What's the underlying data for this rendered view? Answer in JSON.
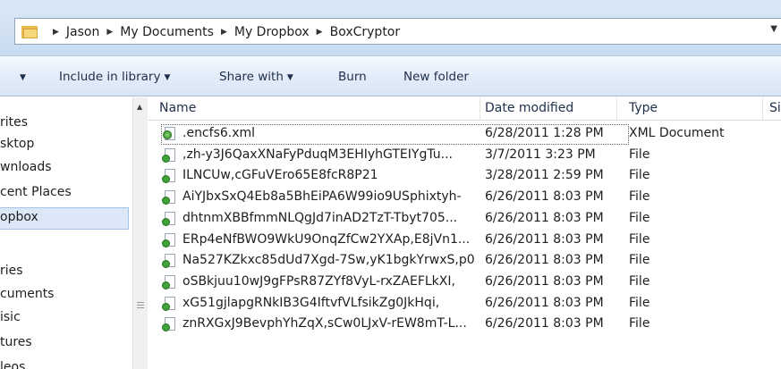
{
  "address_bar": {
    "crumbs": [
      "Jason",
      "My Documents",
      "My Dropbox",
      "BoxCryptor"
    ],
    "separator": "▶",
    "dropdown": "▼"
  },
  "toolbar": {
    "organize_caret": "▼",
    "include_in_library": "Include in library",
    "share_with": "Share with",
    "burn": "Burn",
    "new_folder": "New folder",
    "caret": "▼"
  },
  "nav": {
    "items": [
      "rites",
      "sktop",
      "wnloads",
      "cent Places",
      "opbox",
      "ries",
      "cuments",
      "isic",
      "tures",
      "leos"
    ],
    "selected_index": 4
  },
  "list": {
    "columns": [
      "Name",
      "Date modified",
      "Type",
      "Si"
    ],
    "files": [
      {
        "name": ".encfs6.xml",
        "date": "6/28/2011 1:28 PM",
        "type": "XML Document",
        "icon": "xml-file-icon"
      },
      {
        "name": ",zh-y3J6QaxXNaFyPduqM3EHIyhGTEIYgTu...",
        "date": "3/7/2011 3:23 PM",
        "type": "File",
        "icon": "file-icon"
      },
      {
        "name": "ILNCUw,cGFuVEro65E8fcR8P21",
        "date": "3/28/2011 2:59 PM",
        "type": "File",
        "icon": "file-icon"
      },
      {
        "name": "AiYJbxSxQ4Eb8a5BhEiPA6W99io9USphixtyh-",
        "date": "6/26/2011 8:03 PM",
        "type": "File",
        "icon": "file-icon"
      },
      {
        "name": "dhtnmXBBfmmNLQgJd7inAD2TzT-Tbyt705...",
        "date": "6/26/2011 8:03 PM",
        "type": "File",
        "icon": "file-icon"
      },
      {
        "name": "ERp4eNfBWO9WkU9OnqZfCw2YXAp,E8jVn1...",
        "date": "6/26/2011 8:03 PM",
        "type": "File",
        "icon": "file-icon"
      },
      {
        "name": "Na527KZkxc85dUd7Xgd-7Sw,yK1bgkYrwxS,p0",
        "date": "6/26/2011 8:03 PM",
        "type": "File",
        "icon": "file-icon"
      },
      {
        "name": "oSBkjuu10wJ9gFPsR87ZYf8VyL-rxZAEFLkXI,",
        "date": "6/26/2011 8:03 PM",
        "type": "File",
        "icon": "file-icon"
      },
      {
        "name": "xG51gjlapgRNkIB3G4IftvfVLfsikZg0JkHqi,",
        "date": "6/26/2011 8:03 PM",
        "type": "File",
        "icon": "file-icon"
      },
      {
        "name": "znRXGxJ9BevphYhZqX,sCw0LJxV-rEW8mT-L...",
        "date": "6/26/2011 8:03 PM",
        "type": "File",
        "icon": "file-icon"
      }
    ]
  },
  "colors": {
    "accent": "#dce8f7",
    "toolbar_text": "#1e2f4a",
    "folder": "#f7d77b",
    "file_badge": "#3fa33a"
  }
}
